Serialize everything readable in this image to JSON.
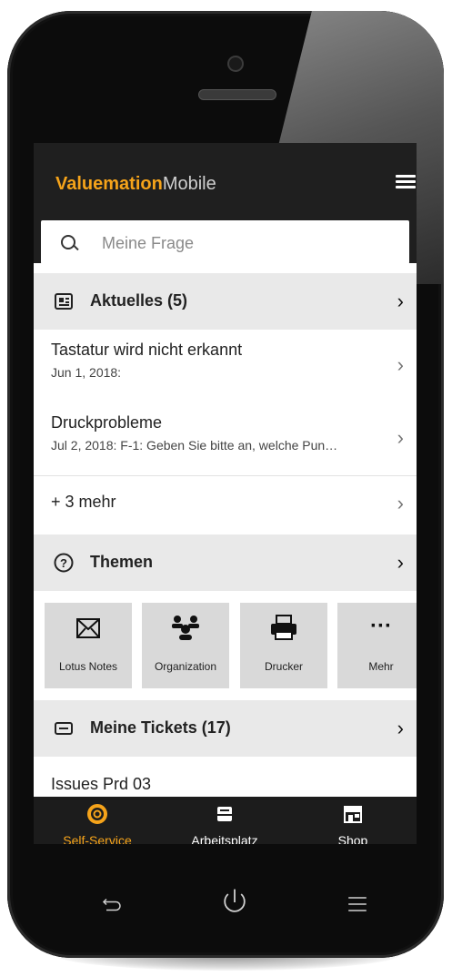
{
  "app": {
    "brand": "Valuemation",
    "brand_suffix": "Mobile"
  },
  "search": {
    "placeholder": "Meine Frage"
  },
  "sections": {
    "news": {
      "title": "Aktuelles (5)",
      "items": [
        {
          "title": "Tastatur wird nicht erkannt",
          "subtitle": "Jun 1, 2018:"
        },
        {
          "title": "Druckprobleme",
          "subtitle": "Jul 2, 2018: F-1: Geben Sie bitte an, welche Pun…"
        }
      ],
      "more": "+ 3 mehr"
    },
    "topics": {
      "title": "Themen",
      "tiles": [
        {
          "label": "Lotus Notes",
          "icon": "envelope-icon"
        },
        {
          "label": "Organization",
          "icon": "people-icon"
        },
        {
          "label": "Drucker",
          "icon": "printer-icon"
        },
        {
          "label": "Mehr",
          "icon": "ellipsis-icon"
        }
      ]
    },
    "tickets": {
      "title": "Meine Tickets (17)",
      "items": [
        {
          "title": "Issues Prd 03"
        }
      ]
    }
  },
  "bottom_nav": [
    {
      "label": "Self-Service",
      "icon": "lifebuoy-icon",
      "active": true
    },
    {
      "label": "Arbeitsplatz",
      "icon": "inbox-icon",
      "active": false
    },
    {
      "label": "Shop",
      "icon": "store-icon",
      "active": false
    }
  ],
  "hardware_buttons": [
    "back-icon",
    "power-icon",
    "menu-icon"
  ],
  "colors": {
    "accent": "#f5a31a",
    "appbar": "#1f1f1f",
    "section_bg": "#e9e9e9",
    "tile_bg": "#d9d9d9"
  }
}
